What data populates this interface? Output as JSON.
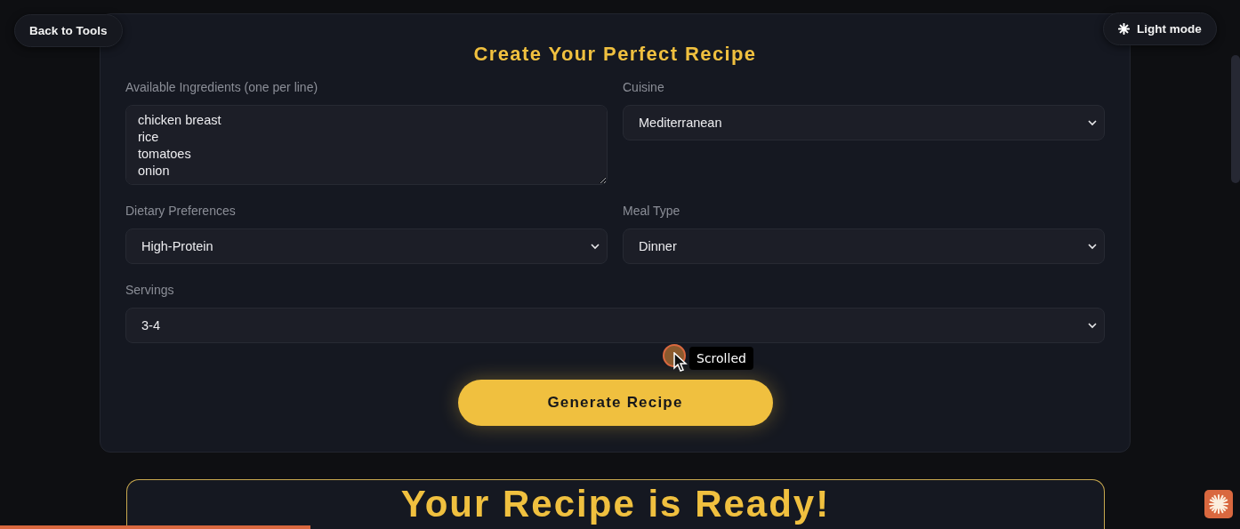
{
  "top_bar": {
    "back_button": "Back to Tools",
    "theme_toggle": "Light mode"
  },
  "form": {
    "title": "Create Your Perfect Recipe",
    "fields": [
      {
        "kind": "textarea",
        "label": "Available Ingredients (one per line)",
        "value": "chicken breast\nrice\ntomatoes\nonion"
      },
      {
        "kind": "select",
        "label": "Cuisine",
        "value": "Mediterranean"
      },
      {
        "kind": "select",
        "label": "Dietary Preferences",
        "value": "High-Protein"
      },
      {
        "kind": "select",
        "label": "Meal Type",
        "value": "Dinner"
      },
      {
        "kind": "select",
        "label": "Servings",
        "value": "3-4"
      }
    ],
    "submit": "Generate Recipe"
  },
  "result": {
    "title": "Your Recipe is Ready!"
  },
  "cursor_tooltip": "Scrolled",
  "progress": {
    "level": 0.25
  }
}
